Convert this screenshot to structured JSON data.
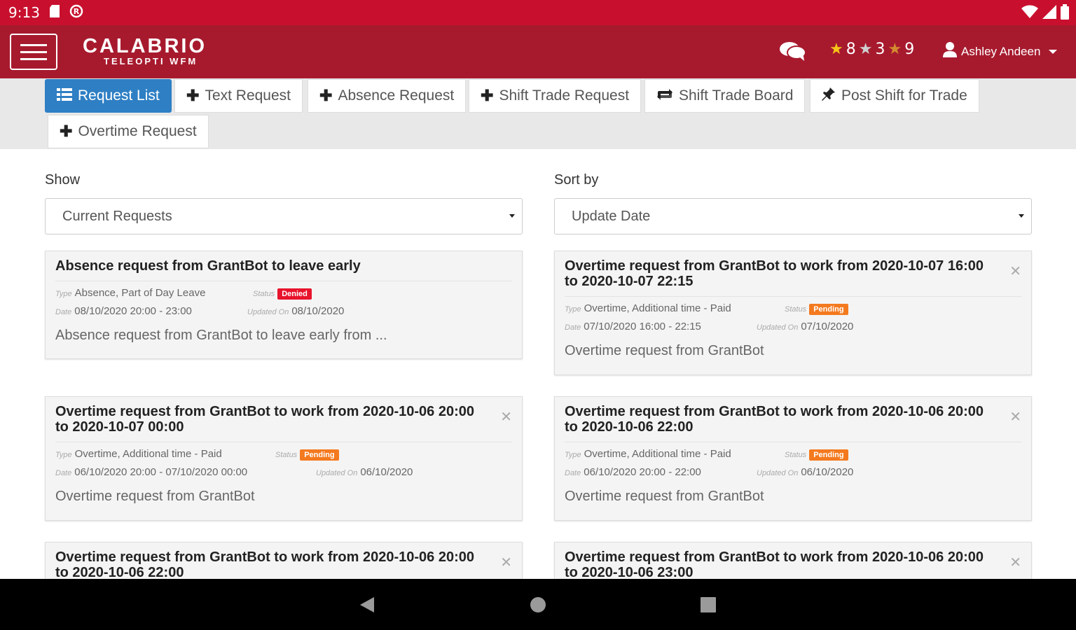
{
  "status_bar": {
    "time": "9:13"
  },
  "header": {
    "brand_main": "CALABRIO",
    "brand_sub": "TELEOPTI WFM",
    "badges": {
      "gold": "8",
      "silver": "3",
      "bronze": "9"
    },
    "user_name": "Ashley Andeen"
  },
  "tabs": [
    {
      "label": "Request List",
      "icon": "list-icon"
    },
    {
      "label": "Text Request",
      "icon": "plus-icon"
    },
    {
      "label": "Absence Request",
      "icon": "plus-icon"
    },
    {
      "label": "Shift Trade Request",
      "icon": "plus-icon"
    },
    {
      "label": "Shift Trade Board",
      "icon": "swap-icon"
    },
    {
      "label": "Post Shift for Trade",
      "icon": "pin-icon"
    },
    {
      "label": "Overtime Request",
      "icon": "plus-icon"
    }
  ],
  "filters": {
    "show_label": "Show",
    "show_value": "Current Requests",
    "sort_label": "Sort by",
    "sort_value": "Update Date"
  },
  "meta_keys": {
    "type": "Type",
    "status": "Status",
    "date": "Date",
    "updated": "Updated On"
  },
  "cards": [
    {
      "title": "Absence request from GrantBot to leave early",
      "type": "Absence, Part of Day Leave",
      "status": "Denied",
      "date": "08/10/2020 20:00 - 23:00",
      "updated": "08/10/2020",
      "description": "Absence request from GrantBot to leave early from ..."
    },
    {
      "title": "Overtime request from GrantBot to work from 2020-10-07 16:00 to 2020-10-07 22:15",
      "type": "Overtime, Additional time - Paid",
      "status": "Pending",
      "date": "07/10/2020 16:00 - 22:15",
      "updated": "07/10/2020",
      "description": "Overtime request from GrantBot"
    },
    {
      "title": "Overtime request from GrantBot to work from 2020-10-06 20:00 to 2020-10-07 00:00",
      "type": "Overtime, Additional time - Paid",
      "status": "Pending",
      "date": "06/10/2020 20:00 - 07/10/2020 00:00",
      "updated": "06/10/2020",
      "description": "Overtime request from GrantBot"
    },
    {
      "title": "Overtime request from GrantBot to work from 2020-10-06 20:00 to 2020-10-06 22:00",
      "type": "Overtime, Additional time - Paid",
      "status": "Pending",
      "date": "06/10/2020 20:00 - 22:00",
      "updated": "06/10/2020",
      "description": "Overtime request from GrantBot"
    },
    {
      "title": "Overtime request from GrantBot to work from 2020-10-06 20:00 to 2020-10-06 22:00"
    },
    {
      "title": "Overtime request from GrantBot to work from 2020-10-06 20:00 to 2020-10-06 23:00"
    }
  ],
  "colors": {
    "status_bar": "#c8102e",
    "header": "#a71a2e",
    "active_tab": "#2e7fc4",
    "denied": "#e8132c",
    "pending": "#f47a1f"
  }
}
